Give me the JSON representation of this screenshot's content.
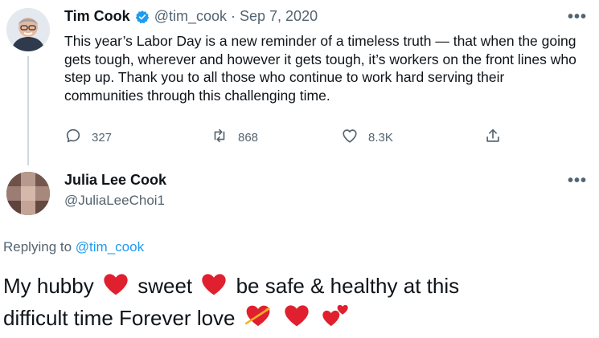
{
  "tweet": {
    "author_name": "Tim Cook",
    "handle": "@tim_cook",
    "separator": "·",
    "date": "Sep 7, 2020",
    "text": "This year’s Labor Day is a new reminder of a timeless truth — that when the going gets tough, wherever and however it gets tough, it’s workers on the front lines who step up. Thank you to all those who continue to work hard serving their communities through this challenging time.",
    "replies": "327",
    "retweets": "868",
    "likes": "8.3K",
    "more": "•••"
  },
  "reply": {
    "author_name": "Julia Lee Cook",
    "handle": "@JuliaLeeChoi1",
    "more": "•••",
    "replying_prefix": "Replying to",
    "replying_to": "@tim_cook",
    "text_1": "My hubby",
    "text_2": "sweet",
    "text_3": "be safe & healthy at this",
    "text_4": "difficult time Forever love"
  },
  "colors": {
    "verified": "#1d9bf0",
    "link": "#1d9bf0",
    "heart": "#e0202e",
    "muted": "#536471"
  },
  "icons": [
    "verified-badge-icon",
    "reply-icon",
    "retweet-icon",
    "like-icon",
    "share-icon",
    "more-icon",
    "red-heart-icon",
    "heart-with-arrow-icon",
    "two-hearts-icon"
  ]
}
